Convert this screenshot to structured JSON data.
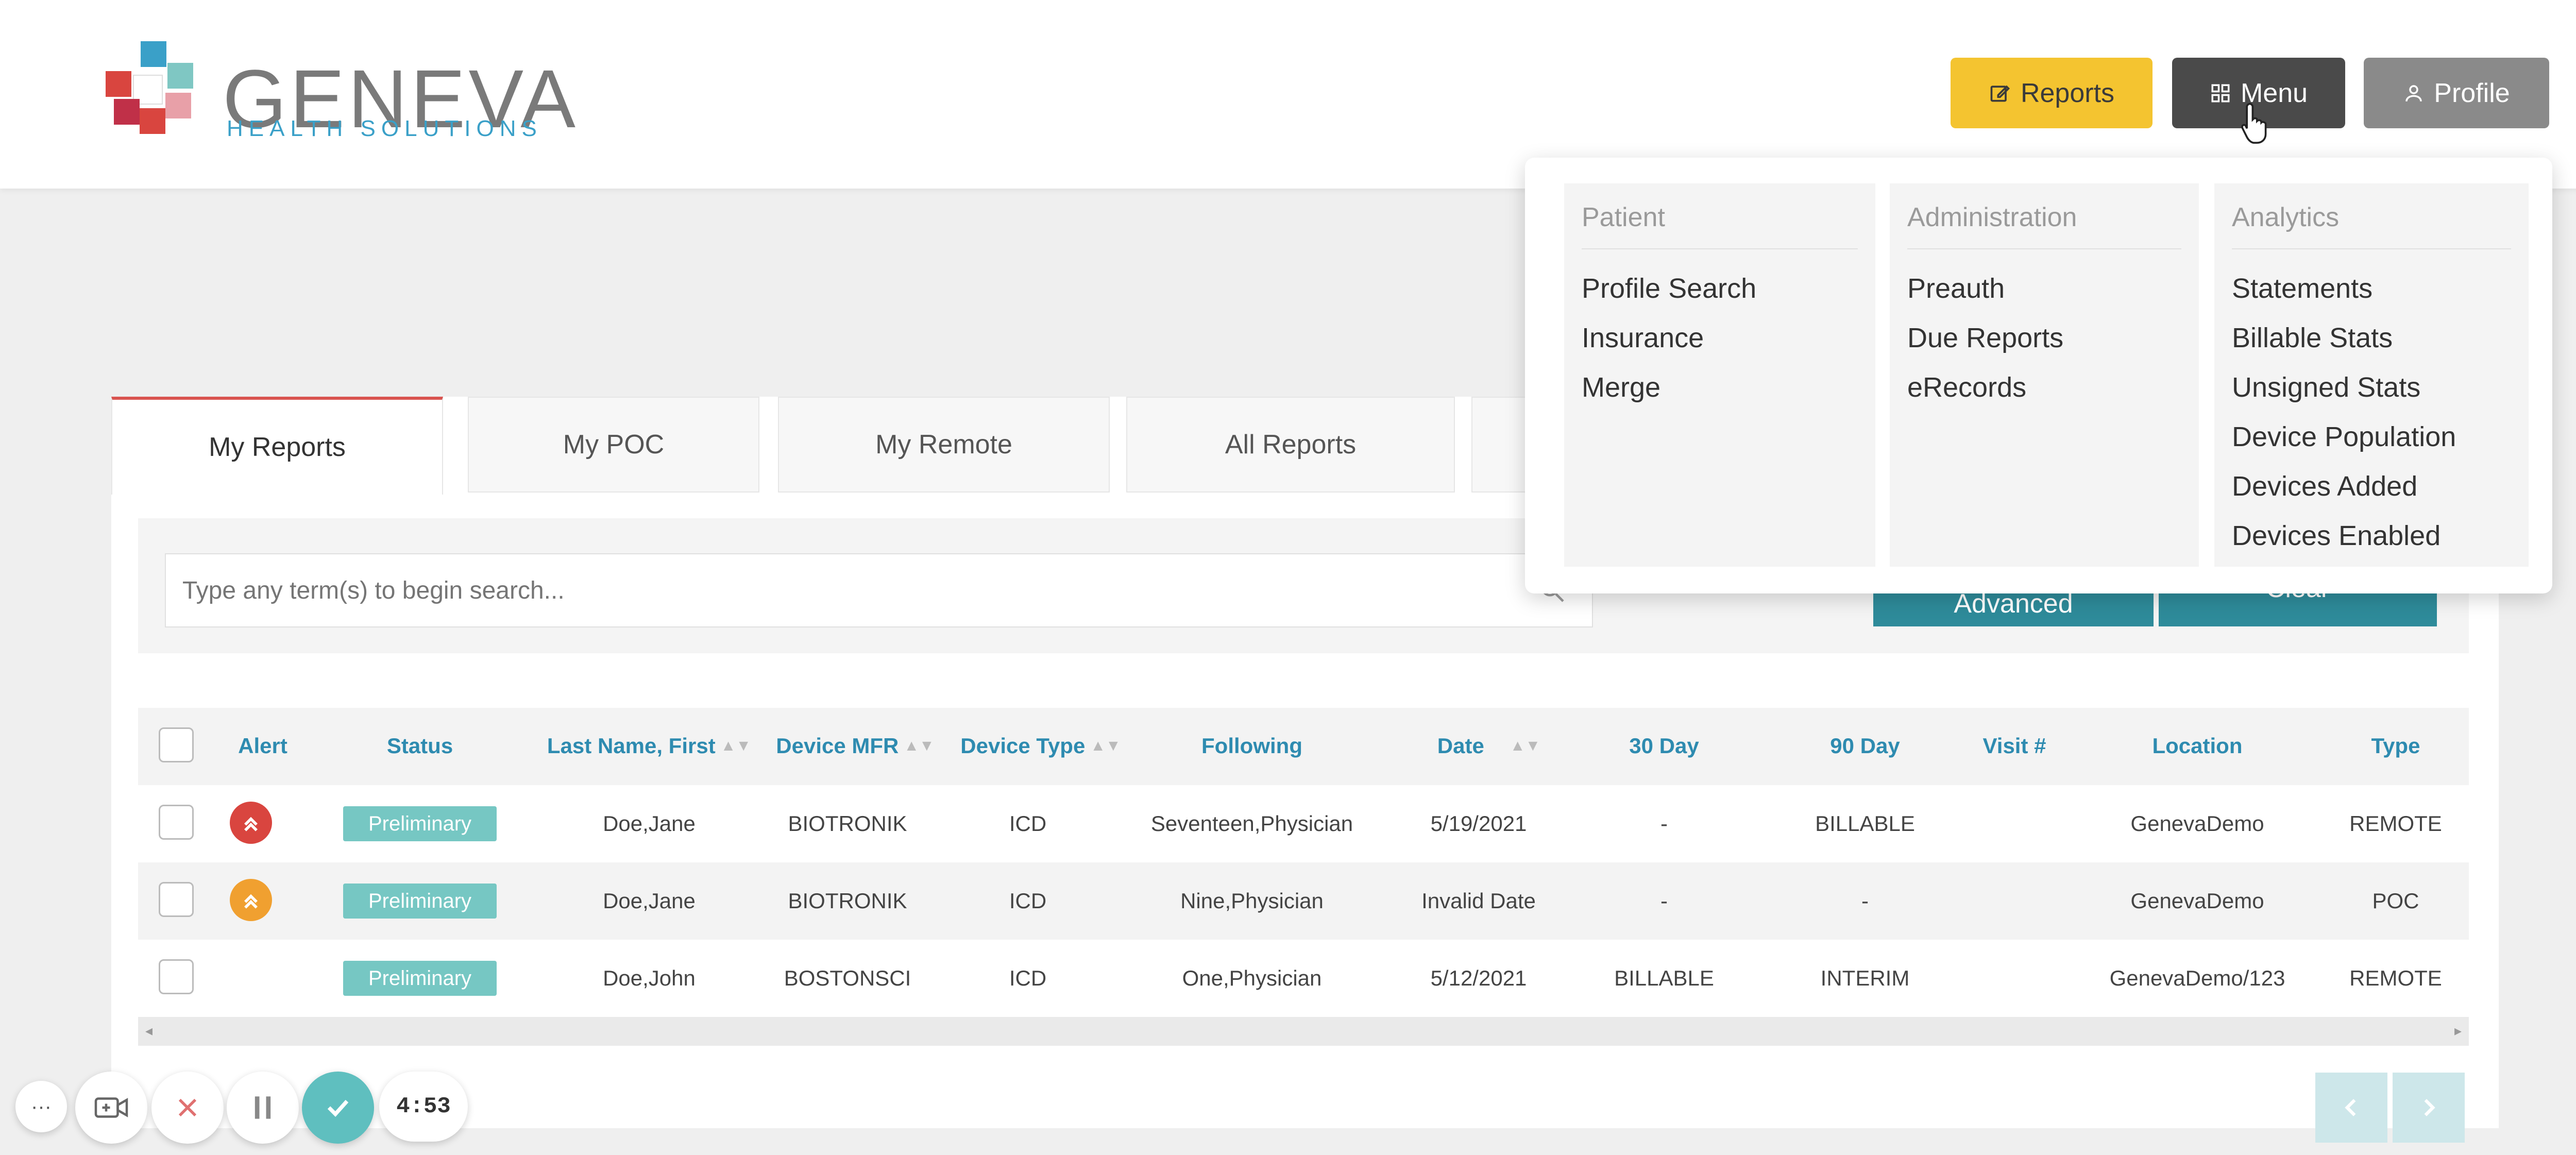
{
  "header": {
    "logo_title": "GENEVA",
    "logo_subtitle": "HEALTH SOLUTIONS",
    "reports_label": "Reports",
    "menu_label": "Menu",
    "profile_label": "Profile"
  },
  "tabs": [
    {
      "label": "My Reports",
      "active": true
    },
    {
      "label": "My POC"
    },
    {
      "label": "My Remote"
    },
    {
      "label": "All Reports"
    }
  ],
  "search": {
    "placeholder": "Type any term(s) to begin search...",
    "advanced_label": "Advanced",
    "clear_label": "Clear"
  },
  "table": {
    "headers": [
      "Alert",
      "Status",
      "Last Name, First",
      "Device MFR",
      "Device Type",
      "Following",
      "Date",
      "30 Day",
      "90 Day",
      "Visit #",
      "Location",
      "Type"
    ],
    "rows": [
      {
        "alert": "red",
        "status": "Preliminary",
        "name": "Doe,Jane",
        "mfr": "BIOTRONIK",
        "device_type": "ICD",
        "following": "Seventeen,Physician",
        "date": "5/19/2021",
        "d30": "-",
        "d90": "BILLABLE",
        "visit": "",
        "location": "GenevaDemo",
        "type": "REMOTE"
      },
      {
        "alert": "orange",
        "status": "Preliminary",
        "name": "Doe,Jane",
        "mfr": "BIOTRONIK",
        "device_type": "ICD",
        "following": "Nine,Physician",
        "date": "Invalid Date",
        "d30": "-",
        "d90": "-",
        "visit": "",
        "location": "GenevaDemo",
        "type": "POC"
      },
      {
        "alert": "",
        "status": "Preliminary",
        "name": "Doe,John",
        "mfr": "BOSTONSCI",
        "device_type": "ICD",
        "following": "One,Physician",
        "date": "5/12/2021",
        "d30": "BILLABLE",
        "d90": "INTERIM",
        "visit": "",
        "location": "GenevaDemo/123",
        "type": "REMOTE"
      }
    ]
  },
  "menu": {
    "columns": [
      {
        "heading": "Patient",
        "items": [
          "Profile Search",
          "Insurance",
          "Merge"
        ]
      },
      {
        "heading": "Administration",
        "items": [
          "Preauth",
          "Due Reports",
          "eRecords"
        ]
      },
      {
        "heading": "Analytics",
        "items": [
          "Statements",
          "Billable Stats",
          "Unsigned Stats",
          "Device Population",
          "Devices Added",
          "Devices Enabled"
        ]
      }
    ]
  },
  "recorder": {
    "timer": "4:53"
  },
  "colors": {
    "accent": "#2e8b9a",
    "reports_button": "#f4c430",
    "alert_red": "#d9453f",
    "alert_orange": "#f0a030",
    "status_badge": "#76c7c3"
  }
}
